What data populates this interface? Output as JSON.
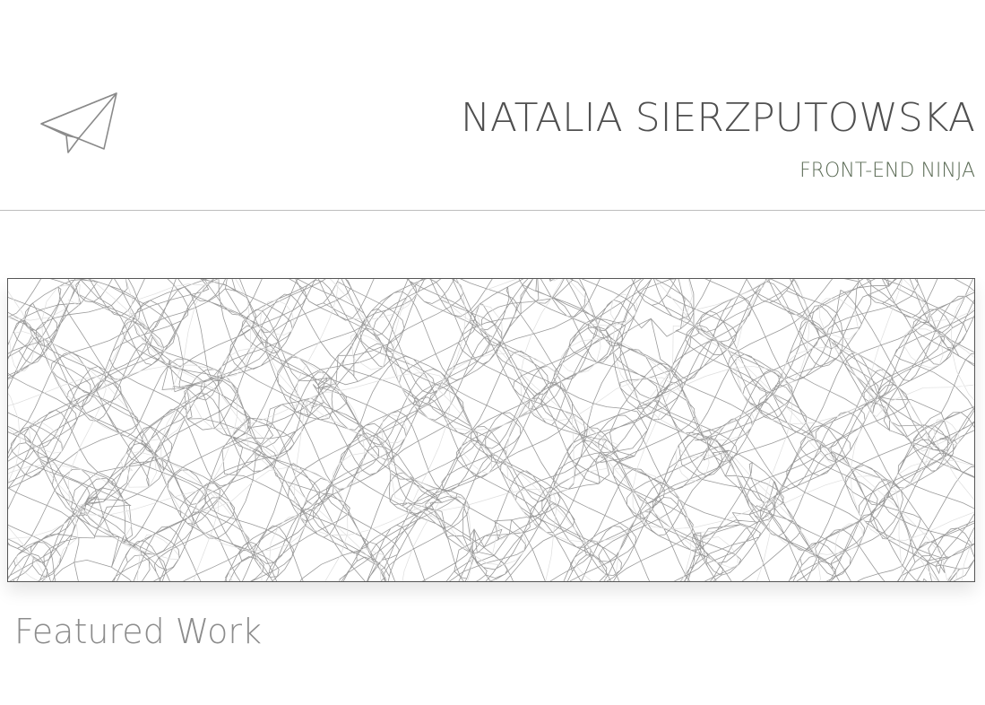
{
  "header": {
    "name": "NATALIA SIERZPUTOWSKA",
    "tagline": "FRONT-END NINJA",
    "logo_icon": "paper-plane-icon"
  },
  "hero": {
    "pattern": "distorted-grid-mosaic"
  },
  "featured": {
    "title": "Featured Work"
  },
  "colors": {
    "name_text": "#505050",
    "tagline_text": "#5b6b55",
    "section_title_text": "#8c8c8c",
    "divider": "#bdbdbd",
    "pattern_line": "#9a9a9a"
  }
}
